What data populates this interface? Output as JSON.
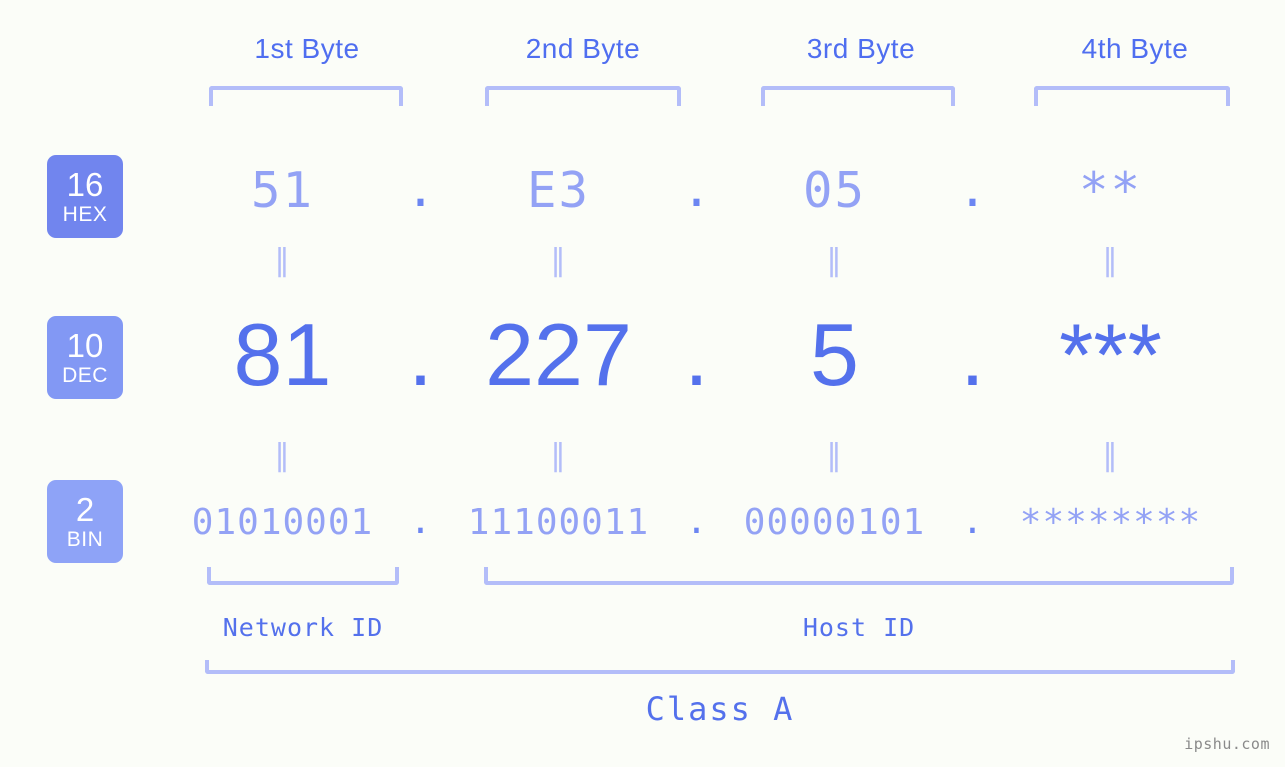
{
  "watermark": "ipshu.com",
  "colors": {
    "background": "#fbfdf8",
    "accent_strong": "#5471ec",
    "accent_light": "#93a2f5",
    "bracket": "#b3bdf9",
    "badge_hex": "#7185ee",
    "badge_dec": "#8298f4",
    "badge_bin": "#8ea3f7"
  },
  "byte_headers": [
    {
      "label": "1st Byte"
    },
    {
      "label": "2nd Byte"
    },
    {
      "label": "3rd Byte"
    },
    {
      "label": "4th Byte"
    }
  ],
  "badges": [
    {
      "base": "16",
      "system": "HEX"
    },
    {
      "base": "10",
      "system": "DEC"
    },
    {
      "base": "2",
      "system": "BIN"
    }
  ],
  "separator": ".",
  "equals_mark": "‖",
  "rows": {
    "hex": {
      "values": [
        "51",
        "E3",
        "05",
        "**"
      ]
    },
    "dec": {
      "values": [
        "81",
        "227",
        "5",
        "***"
      ]
    },
    "bin": {
      "values": [
        "01010001",
        "11100011",
        "00000101",
        "********"
      ]
    }
  },
  "segments": {
    "network_id": "Network ID",
    "host_id": "Host ID"
  },
  "class": {
    "label": "Class A"
  }
}
